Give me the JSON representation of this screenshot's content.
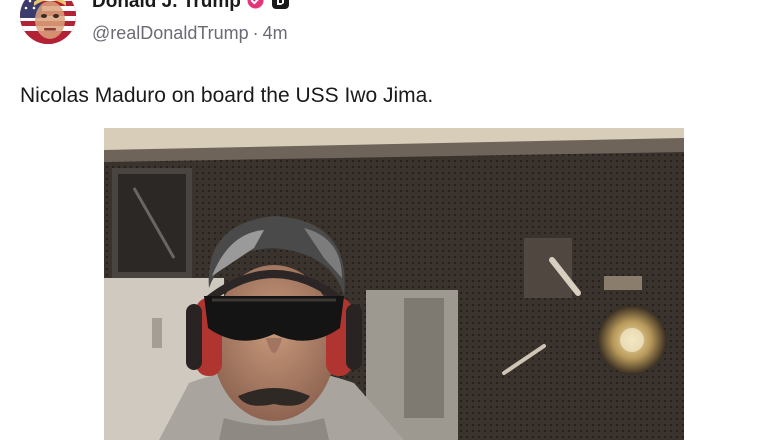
{
  "author": {
    "display_name": "Donald J. Trump",
    "handle": "@realDonaldTrump",
    "separator": "·",
    "time_ago": "4m",
    "verified_color": "#e5357a"
  },
  "post": {
    "text": "Nicolas Maduro on board the USS Iwo Jima."
  },
  "icons": {
    "verified": "verified-badge-icon",
    "affiliate": "affiliate-badge-icon"
  }
}
